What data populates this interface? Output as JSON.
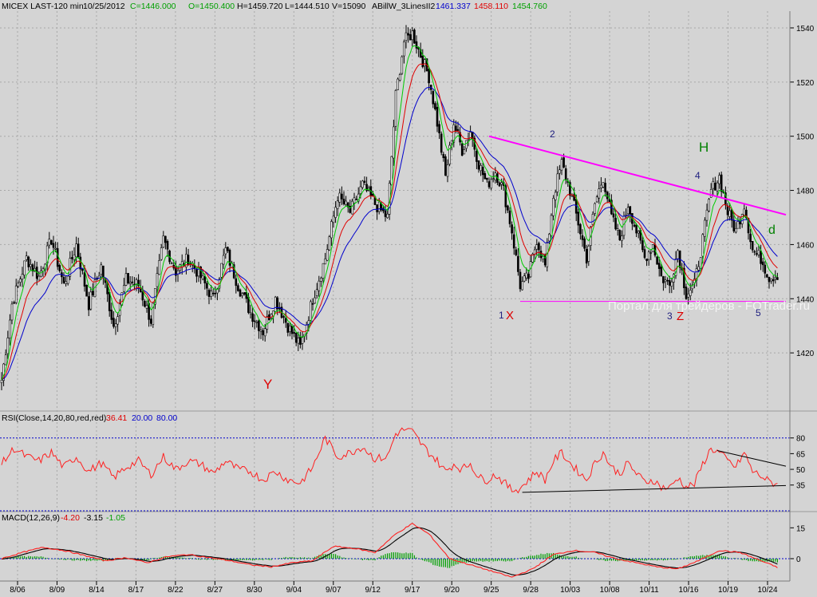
{
  "header": {
    "symbol": "MICEX LAST-120 min",
    "date": "10/25/2012",
    "close": "C=1446.000",
    "open": "O=1450.400",
    "high": "H=1459.720",
    "low": "L=1444.510",
    "volume": "V=15090",
    "indicator": "ABillW_3LinesII2",
    "ind_blue": "1461.337",
    "ind_red": "1458.110",
    "ind_green": "1454.760"
  },
  "watermark": "Портал для трейдеров - FOTrader.ru",
  "labels": {
    "Y": "Y",
    "X": "X",
    "Z": "Z",
    "H": "H",
    "d": "d",
    "w1": "1",
    "w2": "2",
    "w3": "3",
    "w4": "4",
    "w5": "5"
  },
  "colors": {
    "background": "#d4d4d4",
    "candle": "#000000",
    "ma_fast": "#00cc00",
    "ma_mid": "#e00000",
    "ma_slow": "#0000cc",
    "trendline": "#ff00ff",
    "rsi": "#ff2020",
    "macd": "#000000",
    "signal": "#ff2020",
    "hist": "#00a000",
    "label_red": "#dd0000",
    "label_blue": "#202080",
    "label_green": "#008000"
  },
  "chart_data": [
    {
      "type": "candlestick",
      "panel": "price",
      "ylim": [
        1400,
        1545
      ],
      "y_ticks": [
        "1420",
        "1440",
        "1460",
        "1480",
        "1500",
        "1520",
        "1540"
      ],
      "x_ticks": [
        "8/06",
        "8/09",
        "8/14",
        "8/17",
        "8/22",
        "8/27",
        "8/30",
        "9/04",
        "9/07",
        "9/12",
        "9/17",
        "9/20",
        "9/25",
        "9/28",
        "10/03",
        "10/08",
        "10/11",
        "10/16",
        "10/19",
        "10/24"
      ],
      "grid": true,
      "anchors": [
        [
          0,
          1410
        ],
        [
          5,
          1438
        ],
        [
          12,
          1455
        ],
        [
          18,
          1448
        ],
        [
          24,
          1462
        ],
        [
          30,
          1445
        ],
        [
          36,
          1460
        ],
        [
          42,
          1438
        ],
        [
          48,
          1452
        ],
        [
          54,
          1430
        ],
        [
          60,
          1447
        ],
        [
          66,
          1445
        ],
        [
          72,
          1432
        ],
        [
          78,
          1462
        ],
        [
          84,
          1450
        ],
        [
          90,
          1455
        ],
        [
          96,
          1448
        ],
        [
          102,
          1440
        ],
        [
          108,
          1458
        ],
        [
          114,
          1445
        ],
        [
          120,
          1435
        ],
        [
          126,
          1428
        ],
        [
          132,
          1440
        ],
        [
          138,
          1430
        ],
        [
          144,
          1422
        ],
        [
          150,
          1440
        ],
        [
          156,
          1455
        ],
        [
          162,
          1478
        ],
        [
          168,
          1472
        ],
        [
          174,
          1482
        ],
        [
          180,
          1475
        ],
        [
          186,
          1470
        ],
        [
          190,
          1515
        ],
        [
          194,
          1535
        ],
        [
          198,
          1538
        ],
        [
          202,
          1530
        ],
        [
          206,
          1522
        ],
        [
          210,
          1505
        ],
        [
          214,
          1485
        ],
        [
          218,
          1505
        ],
        [
          222,
          1495
        ],
        [
          226,
          1502
        ],
        [
          230,
          1490
        ],
        [
          234,
          1482
        ],
        [
          238,
          1487
        ],
        [
          242,
          1480
        ],
        [
          246,
          1465
        ],
        [
          250,
          1445
        ],
        [
          254,
          1448
        ],
        [
          258,
          1462
        ],
        [
          262,
          1452
        ],
        [
          266,
          1478
        ],
        [
          270,
          1490
        ],
        [
          274,
          1480
        ],
        [
          278,
          1468
        ],
        [
          282,
          1455
        ],
        [
          286,
          1475
        ],
        [
          290,
          1485
        ],
        [
          294,
          1470
        ],
        [
          298,
          1462
        ],
        [
          302,
          1475
        ],
        [
          306,
          1465
        ],
        [
          310,
          1455
        ],
        [
          314,
          1460
        ],
        [
          318,
          1448
        ],
        [
          322,
          1445
        ],
        [
          326,
          1458
        ],
        [
          330,
          1442
        ],
        [
          334,
          1445
        ],
        [
          338,
          1462
        ],
        [
          342,
          1480
        ],
        [
          346,
          1485
        ],
        [
          350,
          1472
        ],
        [
          354,
          1465
        ],
        [
          358,
          1475
        ],
        [
          362,
          1458
        ],
        [
          366,
          1455
        ],
        [
          370,
          1448
        ],
        [
          374,
          1449
        ]
      ],
      "last_bar": {
        "open": 1450.4,
        "high": 1459.72,
        "low": 1444.51,
        "close": 1446.0,
        "volume": 15090
      },
      "indicator_last": {
        "blue": 1461.337,
        "red": 1458.11,
        "green": 1454.76
      },
      "annotations": [
        {
          "text": "Y",
          "x": 130,
          "y": 1418
        },
        {
          "text": "1",
          "x": 246,
          "y": 1434
        },
        {
          "text": "X",
          "x": 250,
          "y": 1434
        },
        {
          "text": "2",
          "x": 272,
          "y": 1497
        },
        {
          "text": "3",
          "x": 330,
          "y": 1434
        },
        {
          "text": "Z",
          "x": 334,
          "y": 1434
        },
        {
          "text": "4",
          "x": 343,
          "y": 1483
        },
        {
          "text": "H",
          "x": 346,
          "y": 1492
        },
        {
          "text": "5",
          "x": 373,
          "y": 1435
        },
        {
          "text": "d",
          "x": 380,
          "y": 1462
        }
      ],
      "trendlines": [
        {
          "from": [
            235,
            1500
          ],
          "to": [
            382,
            1471
          ],
          "color": "#ff00ff"
        },
        {
          "from": [
            250,
            1439
          ],
          "to": [
            382,
            1439
          ],
          "color": "#ff00ff"
        }
      ]
    },
    {
      "type": "line",
      "panel": "rsi",
      "title": "RSI(Close,14,20,80,red,red)",
      "value_last": "36.41",
      "lower": "20.00",
      "upper": "80.00",
      "ylim": [
        18,
        92
      ],
      "y_ticks": [
        "35",
        "50",
        "65",
        "80"
      ],
      "anchors": [
        [
          0,
          55
        ],
        [
          6,
          70
        ],
        [
          12,
          62
        ],
        [
          18,
          58
        ],
        [
          24,
          66
        ],
        [
          30,
          52
        ],
        [
          36,
          62
        ],
        [
          42,
          48
        ],
        [
          48,
          56
        ],
        [
          54,
          42
        ],
        [
          60,
          52
        ],
        [
          66,
          58
        ],
        [
          72,
          45
        ],
        [
          78,
          62
        ],
        [
          84,
          50
        ],
        [
          90,
          58
        ],
        [
          96,
          55
        ],
        [
          102,
          46
        ],
        [
          108,
          58
        ],
        [
          114,
          50
        ],
        [
          120,
          48
        ],
        [
          126,
          40
        ],
        [
          132,
          48
        ],
        [
          138,
          40
        ],
        [
          144,
          37
        ],
        [
          150,
          52
        ],
        [
          156,
          80
        ],
        [
          162,
          62
        ],
        [
          168,
          66
        ],
        [
          174,
          72
        ],
        [
          180,
          60
        ],
        [
          186,
          62
        ],
        [
          190,
          84
        ],
        [
          194,
          88
        ],
        [
          198,
          86
        ],
        [
          202,
          75
        ],
        [
          206,
          66
        ],
        [
          210,
          58
        ],
        [
          214,
          48
        ],
        [
          218,
          55
        ],
        [
          222,
          50
        ],
        [
          226,
          56
        ],
        [
          230,
          42
        ],
        [
          234,
          40
        ],
        [
          238,
          45
        ],
        [
          242,
          38
        ],
        [
          246,
          30
        ],
        [
          250,
          32
        ],
        [
          254,
          40
        ],
        [
          258,
          48
        ],
        [
          262,
          40
        ],
        [
          266,
          58
        ],
        [
          270,
          66
        ],
        [
          274,
          56
        ],
        [
          278,
          48
        ],
        [
          282,
          40
        ],
        [
          286,
          56
        ],
        [
          290,
          66
        ],
        [
          294,
          52
        ],
        [
          298,
          46
        ],
        [
          302,
          56
        ],
        [
          306,
          46
        ],
        [
          310,
          38
        ],
        [
          314,
          40
        ],
        [
          318,
          33
        ],
        [
          322,
          32
        ],
        [
          326,
          42
        ],
        [
          330,
          33
        ],
        [
          334,
          36
        ],
        [
          338,
          55
        ],
        [
          342,
          70
        ],
        [
          346,
          66
        ],
        [
          350,
          58
        ],
        [
          354,
          52
        ],
        [
          358,
          66
        ],
        [
          362,
          48
        ],
        [
          366,
          44
        ],
        [
          370,
          38
        ],
        [
          374,
          36
        ]
      ],
      "trendlines": [
        {
          "from": [
            251,
            28
          ],
          "to": [
            392,
            34.5
          ]
        },
        {
          "from": [
            345,
            68
          ],
          "to": [
            392,
            53
          ]
        }
      ]
    },
    {
      "type": "line",
      "panel": "macd",
      "title": "MACD(12,26,9)",
      "values_last": [
        "-4.20",
        "-3.15",
        "-1.05"
      ],
      "ylim": [
        -7,
        19
      ],
      "y_ticks": [
        "0",
        "15"
      ],
      "anchors": [
        [
          0,
          0
        ],
        [
          10,
          3
        ],
        [
          20,
          5.5
        ],
        [
          30,
          4
        ],
        [
          40,
          1.5
        ],
        [
          50,
          -1
        ],
        [
          60,
          0.5
        ],
        [
          70,
          -2
        ],
        [
          80,
          1
        ],
        [
          90,
          2
        ],
        [
          100,
          0.5
        ],
        [
          110,
          -1
        ],
        [
          120,
          -3
        ],
        [
          130,
          -4
        ],
        [
          140,
          -2
        ],
        [
          150,
          -1
        ],
        [
          160,
          6
        ],
        [
          170,
          5
        ],
        [
          180,
          3
        ],
        [
          190,
          12
        ],
        [
          198,
          17
        ],
        [
          206,
          12
        ],
        [
          216,
          0
        ],
        [
          226,
          -3
        ],
        [
          236,
          -6
        ],
        [
          246,
          -9
        ],
        [
          256,
          -5
        ],
        [
          266,
          2
        ],
        [
          276,
          4
        ],
        [
          286,
          3
        ],
        [
          296,
          0
        ],
        [
          306,
          -2
        ],
        [
          316,
          -4
        ],
        [
          326,
          -5
        ],
        [
          336,
          -1
        ],
        [
          346,
          4
        ],
        [
          356,
          3
        ],
        [
          366,
          -1
        ],
        [
          374,
          -4.2
        ]
      ]
    }
  ]
}
